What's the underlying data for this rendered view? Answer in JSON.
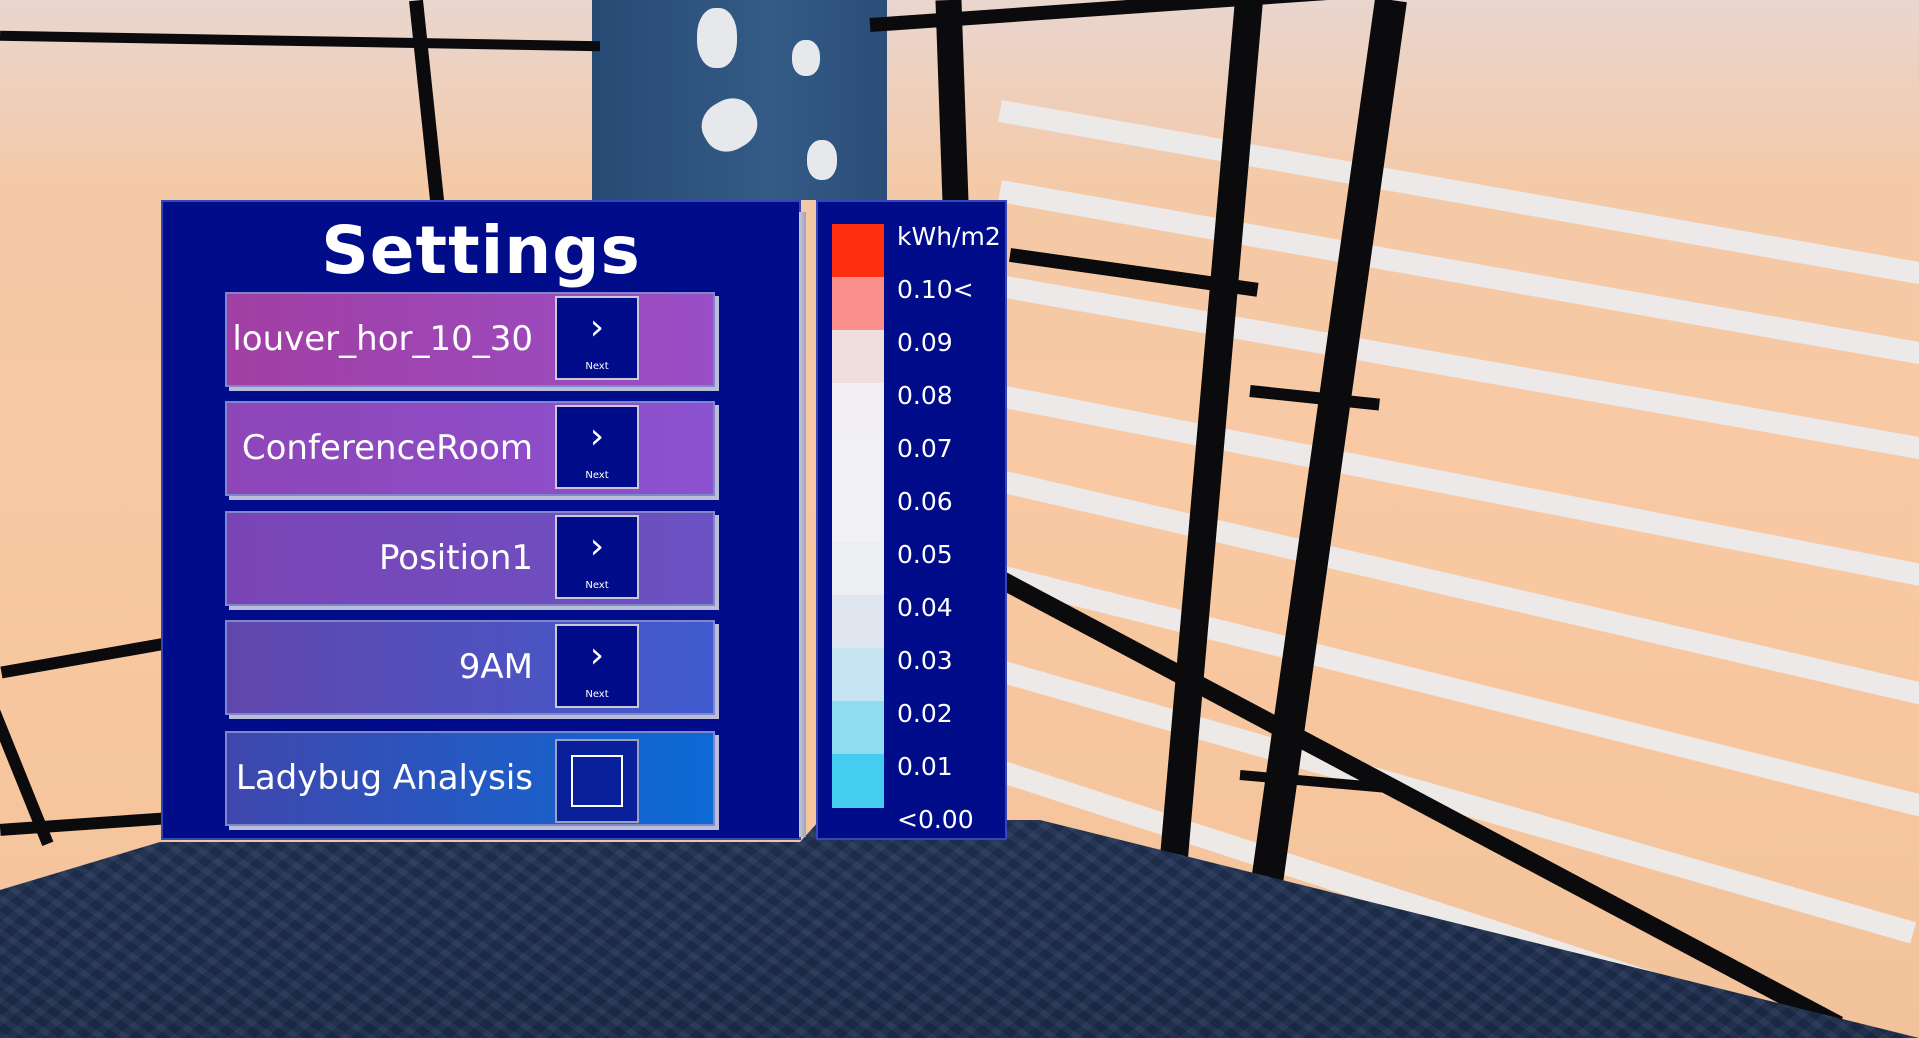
{
  "settings": {
    "title": "Settings",
    "rows": [
      {
        "label": "louver_hor_10_30",
        "button_label": "Next",
        "button_icon": "chevron-right-icon",
        "gradient": [
          "#a13fa3",
          "#9a4ec7"
        ]
      },
      {
        "label": "ConferenceRoom",
        "button_label": "Next",
        "button_icon": "chevron-right-icon",
        "gradient": [
          "#8e45b8",
          "#8d52d0"
        ]
      },
      {
        "label": "Position1",
        "button_label": "Next",
        "button_icon": "chevron-right-icon",
        "gradient": [
          "#7b44b6",
          "#6a52c2"
        ]
      },
      {
        "label": "9AM",
        "button_label": "Next",
        "button_icon": "chevron-right-icon",
        "gradient": [
          "#6147ad",
          "#3f5bcf"
        ]
      },
      {
        "label": "Ladybug Analysis",
        "toggle_icon": "checkbox-icon",
        "checked": false,
        "gradient": [
          "#3f47ad",
          "#0b6ad6"
        ]
      }
    ]
  },
  "legend": {
    "unit": "kWh/m2",
    "labels": [
      "0.10<",
      "0.09",
      "0.08",
      "0.07",
      "0.06",
      "0.05",
      "0.04",
      "0.03",
      "0.02",
      "0.01",
      "<0.00"
    ],
    "colors": [
      "#ff3010",
      "#fa8f8c",
      "#f0dedf",
      "#f2eff2",
      "#f1f1f4",
      "#f1f1f4",
      "#eceef2",
      "#e0e6ef",
      "#c6e4f1",
      "#8fdcf0",
      "#45cdf1"
    ]
  }
}
